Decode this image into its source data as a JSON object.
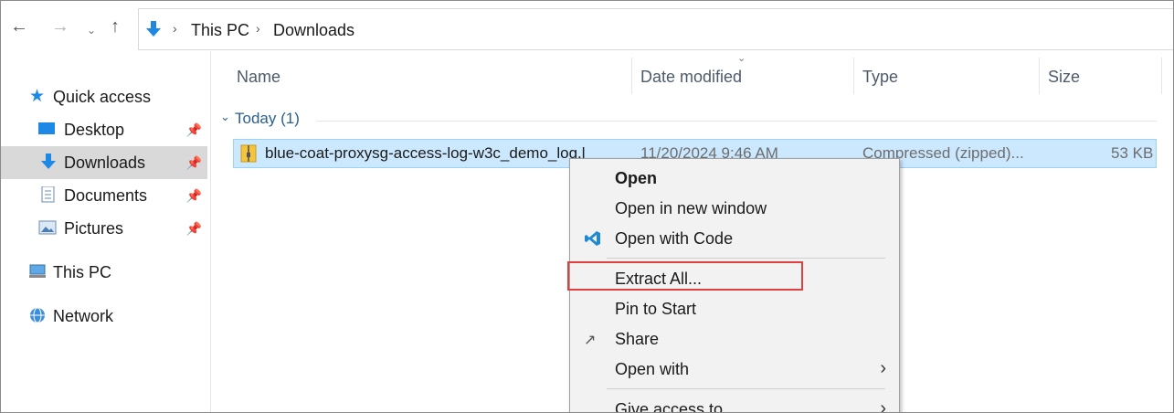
{
  "address": {
    "crumbs": [
      "This PC",
      "Downloads"
    ]
  },
  "nav": {
    "back_icon": "arrow-left-icon",
    "forward_icon": "arrow-right-icon",
    "recent_icon": "chevron-down-icon",
    "up_icon": "arrow-up-icon"
  },
  "sidebar": {
    "quick_access": "Quick access",
    "items": [
      {
        "label": "Desktop",
        "icon": "desktop-icon",
        "pinned": true
      },
      {
        "label": "Downloads",
        "icon": "downloads-icon",
        "pinned": true,
        "selected": true
      },
      {
        "label": "Documents",
        "icon": "documents-icon",
        "pinned": true
      },
      {
        "label": "Pictures",
        "icon": "pictures-icon",
        "pinned": true
      }
    ],
    "this_pc": "This PC",
    "network": "Network"
  },
  "columns": {
    "name": "Name",
    "date": "Date modified",
    "type": "Type",
    "size": "Size"
  },
  "group": {
    "label": "Today (1)"
  },
  "file": {
    "name": "blue-coat-proxysg-access-log-w3c_demo_log.l",
    "date": "11/20/2024 9:46 AM",
    "type": "Compressed (zipped)...",
    "size": "53 KB"
  },
  "context_menu": {
    "open": "Open",
    "open_new_window": "Open in new window",
    "open_with_code": "Open with Code",
    "extract_all": "Extract All...",
    "pin_to_start": "Pin to Start",
    "share": "Share",
    "open_with": "Open with",
    "give_access": "Give access to"
  },
  "colors": {
    "selection": "#cce8ff",
    "accent": "#0078d4",
    "highlight_box": "#e04040"
  }
}
